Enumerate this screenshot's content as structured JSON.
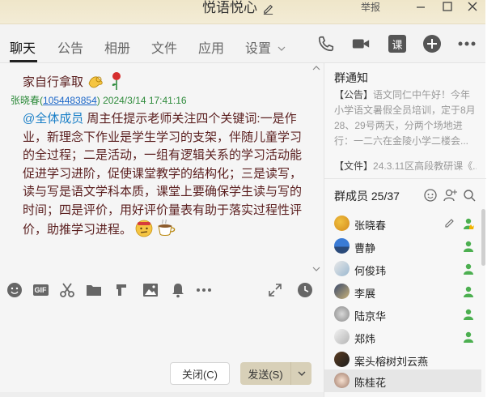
{
  "window": {
    "title": "悦语悦心",
    "report_label": "举报"
  },
  "tabs": [
    {
      "label": "聊天",
      "active": true
    },
    {
      "label": "公告"
    },
    {
      "label": "相册"
    },
    {
      "label": "文件"
    },
    {
      "label": "应用"
    },
    {
      "label": "设置"
    }
  ],
  "toolbar_icons": [
    "phone-icon",
    "video-icon",
    "lesson-icon",
    "add-icon",
    "more-icon"
  ],
  "lesson_icon_text": "课",
  "chat": {
    "prev_line": "家自行拿取",
    "sender": {
      "name": "张晓春",
      "qq": "1054483854",
      "time": "2024/3/14 17:41:16"
    },
    "mention": "@全体成员",
    "message": " 周主任提示老师关注四个关键词:一是作业，新理念下作业是学生学习的支架，伴随儿童学习的全过程；二是活动，一组有逻辑关系的学习活动能促进学习进阶，促使课堂教学的结构化；三是读写，读与写是语文学科本质，课堂上要确保学生读与写的时间；四是评价，用好评价量表有助于落实过程性评价，助推学习进程。"
  },
  "input_toolbar_icons": [
    "emoji-icon",
    "gif-icon",
    "scissors-icon",
    "folder-icon",
    "music-icon",
    "image-icon",
    "bell-icon",
    "more-icon",
    "expand-icon",
    "history-icon"
  ],
  "gif_label": "GIF",
  "buttons": {
    "close": "关闭(C)",
    "send": "发送(S)"
  },
  "group_notice": {
    "title": "群通知",
    "tag": "【公告】",
    "text": "语文同仁中午好！今年小学语文暑假全员培训，定于8月28、29号两天，分两个场地进行：一二六在金陵小学二楼会...",
    "file_tag": "【文件】",
    "file_text": "24.3.11区高段教研课《..."
  },
  "members": {
    "title": "群成员 25/37",
    "list": [
      {
        "name": "张晓春",
        "role": "owner"
      },
      {
        "name": "曹静"
      },
      {
        "name": "何俊玮"
      },
      {
        "name": "李展"
      },
      {
        "name": "陆京华"
      },
      {
        "name": "郑炜"
      },
      {
        "name": "案头榕树刘云燕"
      },
      {
        "name": "陈桂花",
        "selected": true
      }
    ]
  },
  "colors": {
    "title_bar": "#efe6c9",
    "message_text": "#5a1e1e",
    "mention": "#1a7fc7",
    "sender": "#2d8a3a",
    "online": "#4caf50",
    "send_button": "#d8d0b8"
  }
}
